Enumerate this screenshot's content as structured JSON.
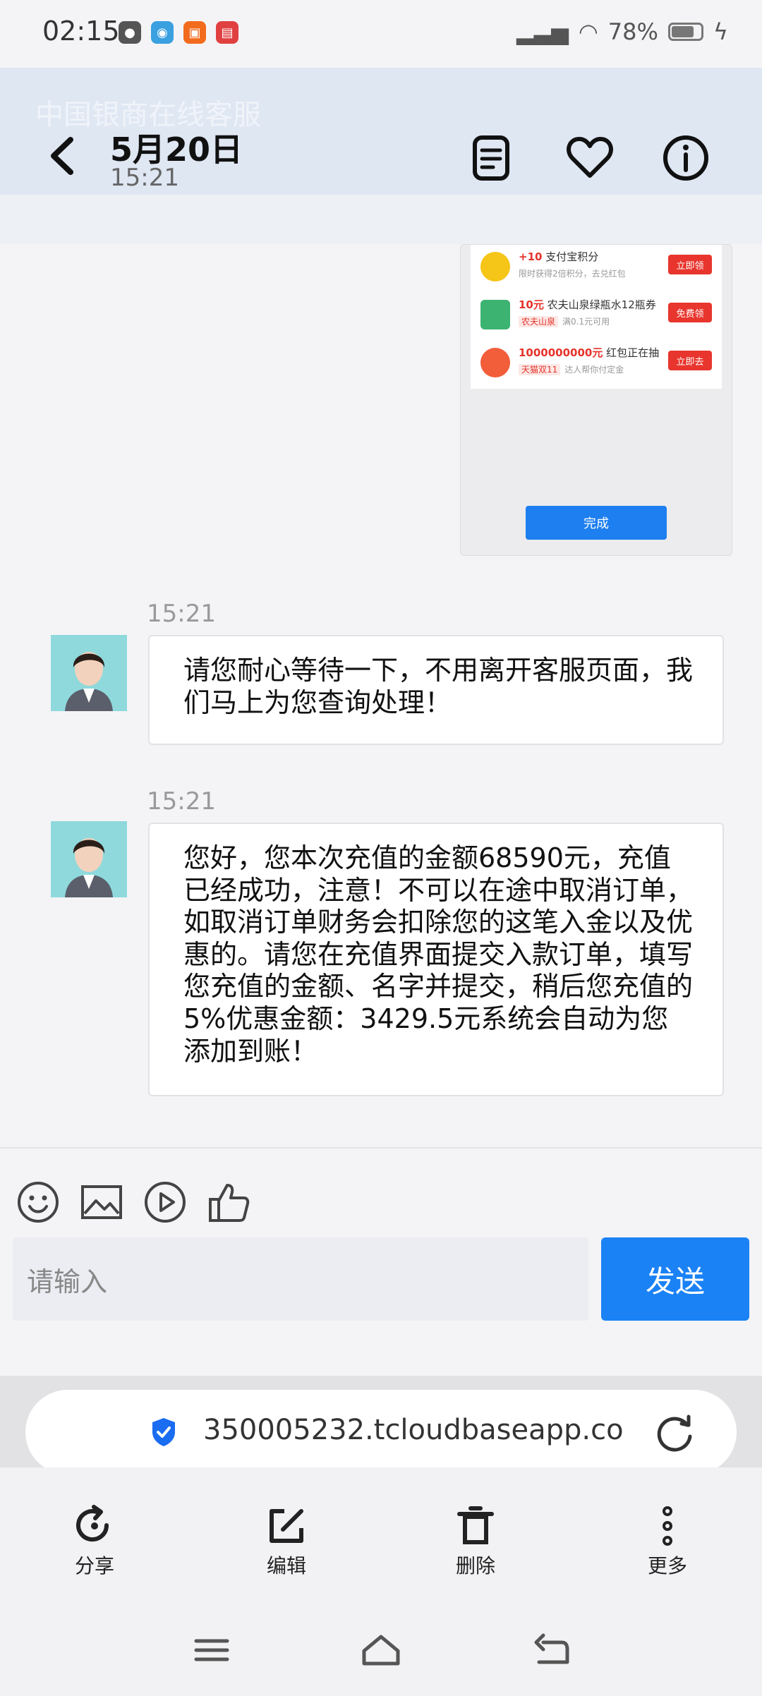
{
  "status_bar": {
    "time": "02:15",
    "battery": "78%"
  },
  "header": {
    "ghost_title": "中国银商在线客服",
    "date": "5月20日",
    "time": "15:21"
  },
  "image_card": {
    "promos": [
      {
        "highlight": "+10",
        "title": "支付宝积分",
        "subtitle": "限时获得2倍积分，去兑红包",
        "tag": "",
        "button": "立即领",
        "color": "#f5c518"
      },
      {
        "highlight": "10元",
        "title": "农夫山泉绿瓶水12瓶券",
        "subtitle": "满0.1元可用",
        "tag": "农夫山泉",
        "button": "免费领",
        "color": "#3cb371"
      },
      {
        "highlight": "1000000000元",
        "title": "红包正在抽",
        "subtitle": "达人帮你付定金",
        "tag": "天猫双11",
        "button": "立即去",
        "color": "#f25d3a"
      }
    ],
    "done_label": "完成"
  },
  "messages": [
    {
      "time": "15:21",
      "text": "请您耐心等待一下，不用离开客服页面，我们马上为您查询处理！"
    },
    {
      "time": "15:21",
      "text": "您好，您本次充值的金额68590元，充值已经成功，注意！不可以在途中取消订单，如取消订单财务会扣除您的这笔入金以及优惠的。请您在充值界面提交入款订单，填写您充值的金额、名字并提交，稍后您充值的5%优惠金额：3429.5元系统会自动为您添加到账！"
    }
  ],
  "toolbar": {
    "icons": [
      "emoji-icon",
      "image-icon",
      "video-icon",
      "thumbs-up-icon"
    ]
  },
  "input": {
    "placeholder": "请输入",
    "send_label": "发送"
  },
  "browser": {
    "url": "350005232.tcloudbaseapp.co",
    "actions": [
      {
        "label": "分享",
        "icon": "share-icon"
      },
      {
        "label": "编辑",
        "icon": "edit-icon"
      },
      {
        "label": "删除",
        "icon": "delete-icon"
      },
      {
        "label": "更多",
        "icon": "more-icon"
      }
    ]
  },
  "nav": {
    "icons": [
      "menu-icon",
      "home-icon",
      "back-icon"
    ]
  }
}
